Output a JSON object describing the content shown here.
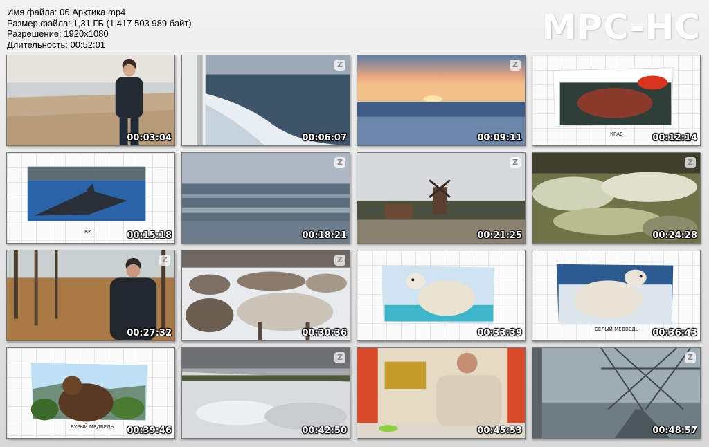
{
  "file_info": {
    "name": "Имя файла: 06 Арктика.mp4",
    "size": "Размер файла: 1,31 ГБ (1 417 503 989 байт)",
    "resolution": "Разрешение: 1920x1080",
    "duration": "Длительность: 00:52:01"
  },
  "logo": "MPC-HC",
  "thumbnails": [
    {
      "time": "00:03:04",
      "scene": "man-on-beach",
      "watermark": false
    },
    {
      "time": "00:06:07",
      "scene": "ship-wake-sea",
      "watermark": true
    },
    {
      "time": "00:09:11",
      "scene": "arctic-sunset",
      "watermark": true
    },
    {
      "time": "00:12:14",
      "scene": "crab-illustration",
      "watermark": false,
      "caption": "КРАБ"
    },
    {
      "time": "00:15:18",
      "scene": "whale-illustration",
      "watermark": false,
      "caption": "КИТ"
    },
    {
      "time": "00:18:21",
      "scene": "grey-sea",
      "watermark": true
    },
    {
      "time": "00:21:25",
      "scene": "windmill-village",
      "watermark": true
    },
    {
      "time": "00:24:28",
      "scene": "tundra-moss",
      "watermark": true
    },
    {
      "time": "00:27:32",
      "scene": "man-in-forest",
      "watermark": true
    },
    {
      "time": "00:30:36",
      "scene": "reindeer-herd",
      "watermark": true
    },
    {
      "time": "00:33:39",
      "scene": "polar-bear-ice",
      "watermark": false
    },
    {
      "time": "00:36:43",
      "scene": "polar-bear-water",
      "watermark": false,
      "caption": "БЕЛЫЙ МЕДВЕДЬ"
    },
    {
      "time": "00:39:46",
      "scene": "brown-bear",
      "watermark": false,
      "caption": "БУРЫЙ МЕДВЕДЬ"
    },
    {
      "time": "00:42:50",
      "scene": "frozen-shore",
      "watermark": true
    },
    {
      "time": "00:45:53",
      "scene": "man-in-kitchen",
      "watermark": false
    },
    {
      "time": "00:48:57",
      "scene": "bridge-road",
      "watermark": true
    }
  ]
}
